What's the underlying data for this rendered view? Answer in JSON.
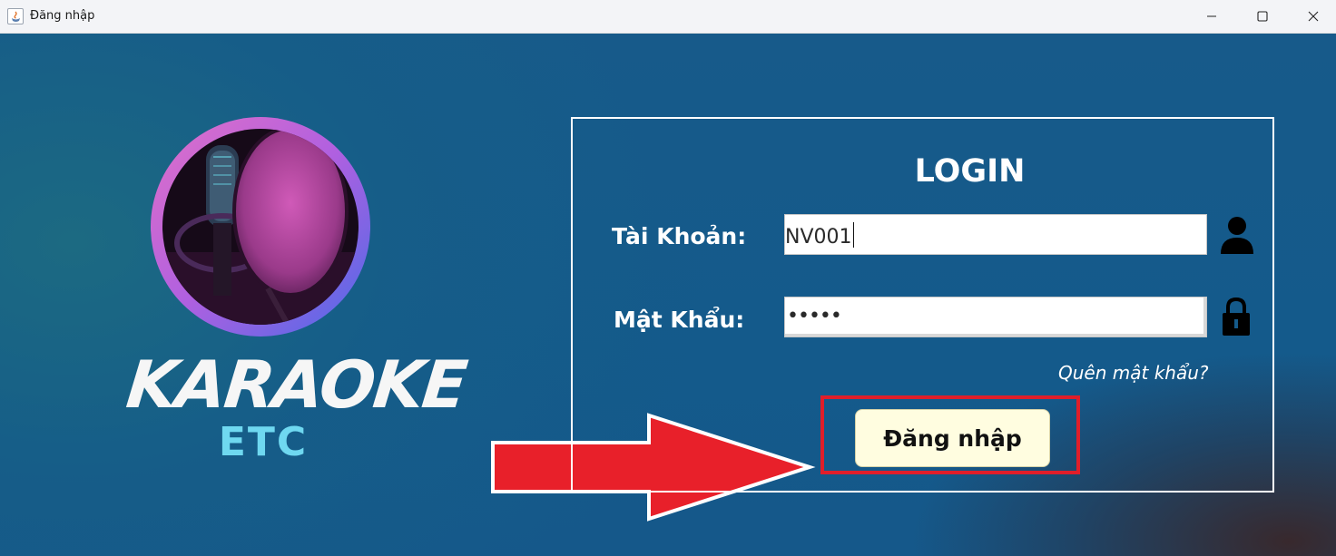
{
  "window": {
    "title": "Đăng nhập",
    "controls": [
      "minimize-icon",
      "maximize-icon",
      "close-icon"
    ]
  },
  "brand": {
    "name": "KARAOKE",
    "sub": "ETC"
  },
  "login": {
    "title": "LOGIN",
    "username_label": "Tài Khoản:",
    "username_value": "NV001",
    "password_label": "Mật Khẩu:",
    "password_masked": "•••••",
    "forgot_link": "Quên mật khẩu?",
    "submit_label": "Đăng nhập"
  },
  "icons": {
    "username": "user-icon",
    "password": "lock-icon"
  },
  "colors": {
    "background": "#155a8a",
    "panel_border": "#ffffff",
    "button_bg": "#fffde0",
    "highlight": "#e01e2a",
    "arrow": "#e8202a",
    "brand_sub": "#6fd8f0"
  }
}
